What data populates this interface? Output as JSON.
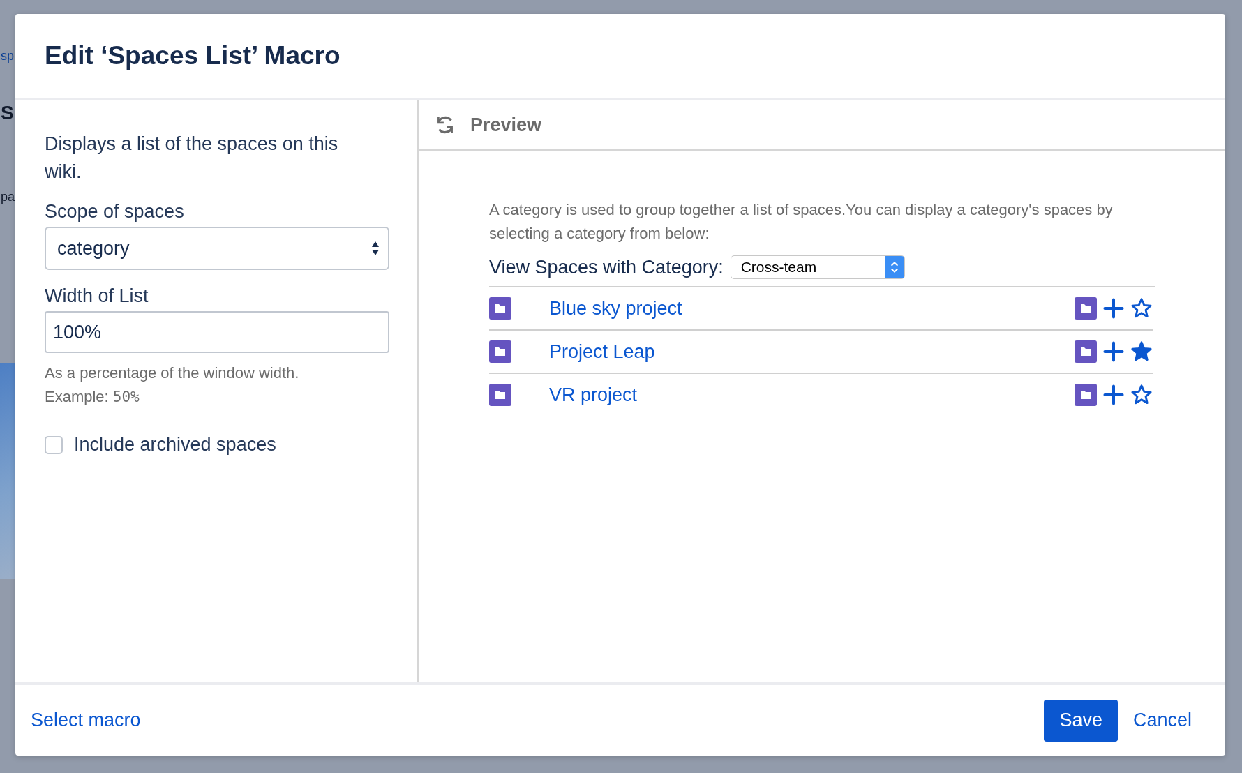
{
  "background": {
    "fragments": [
      {
        "text": "sp",
        "kind": "link"
      },
      {
        "text": "S",
        "kind": "heading"
      },
      {
        "text": "pa",
        "kind": "text"
      }
    ]
  },
  "dialog": {
    "title": "Edit ‘Spaces List’ Macro"
  },
  "settings": {
    "description": "Displays a list of the spaces on this wiki.",
    "fields": [
      {
        "kind": "select",
        "label": "Scope of spaces",
        "value": "category"
      },
      {
        "kind": "text",
        "label": "Width of List",
        "value": "100%",
        "hint": "As a percentage of the window width.",
        "hint_example_label": "Example:",
        "hint_example_value": "50%"
      },
      {
        "kind": "checkbox",
        "label": "Include archived spaces",
        "checked": false
      }
    ]
  },
  "preview": {
    "title": "Preview",
    "intro": "A category is used to group together a list of spaces.You can display a category's spaces by selecting a category from below:",
    "category_label": "View Spaces with Category:",
    "category_value": "Cross-team",
    "spaces": [
      {
        "name": "Blue sky project",
        "favourite": false
      },
      {
        "name": "Project Leap",
        "favourite": true
      },
      {
        "name": "VR project",
        "favourite": false
      }
    ]
  },
  "footer": {
    "link": "Select macro",
    "buttons": [
      {
        "label": "Save",
        "kind": "primary"
      },
      {
        "label": "Cancel",
        "kind": "link"
      }
    ]
  }
}
